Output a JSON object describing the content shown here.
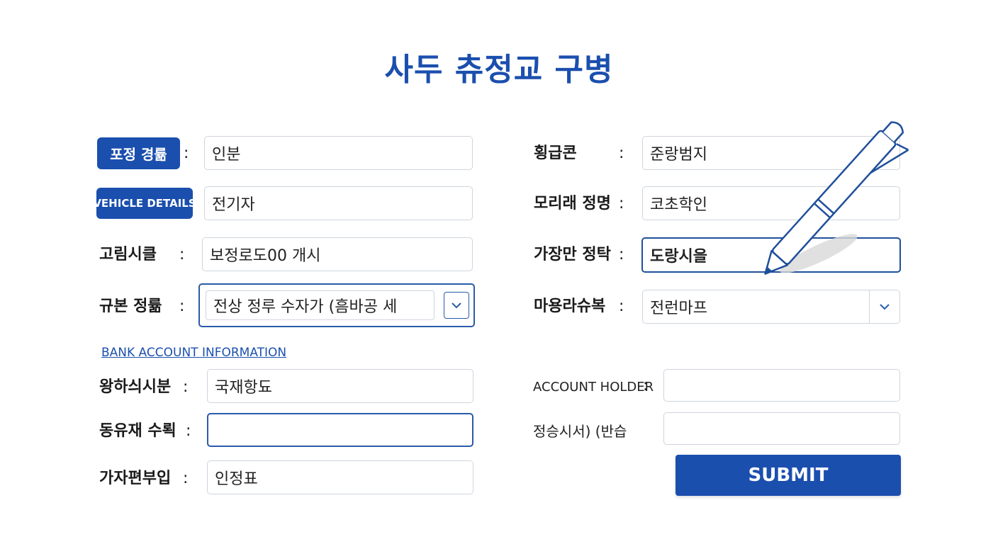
{
  "title": "사두 츄정교 구병",
  "left": {
    "row1": {
      "pill": "포정 경륢",
      "value": "인분"
    },
    "row2": {
      "pill": "VEHICLE DETAILS",
      "value": "전기자"
    },
    "row3": {
      "label": "고림시클",
      "value": "보정로도00 개시"
    },
    "row4": {
      "label": "규본 정륢",
      "value": "전상 정루 수자가 (흠바공 세"
    }
  },
  "right": {
    "row1": {
      "label": "횡급콘",
      "value": "준랑범지"
    },
    "row2": {
      "label": "모리래 정명",
      "value": "코초학인"
    },
    "row3": {
      "label": "가장만 정탁",
      "value": "도랑시을"
    },
    "row4": {
      "label": "마용라슈복",
      "value": "전런마프"
    }
  },
  "bank": {
    "section_label": "BANK ACCOUNT INFORMATION",
    "row1": {
      "label": "왕하싀시분",
      "value": "국재항됴"
    },
    "row2": {
      "label": "동유재 수뢱",
      "value": ""
    },
    "row3": {
      "label": "가자편부입",
      "value": "인정표"
    },
    "holder": {
      "label": "ACCOUNT HOLDER",
      "value": ""
    },
    "other": {
      "label": "정승시서) (반습",
      "value": ""
    }
  },
  "colon": ":",
  "submit_label": "SUBMIT",
  "icons": {
    "select": "chevron-down-icon",
    "decor": "pen-icon"
  },
  "colors": {
    "accent": "#1b4fae",
    "border": "#cfd5dd"
  }
}
